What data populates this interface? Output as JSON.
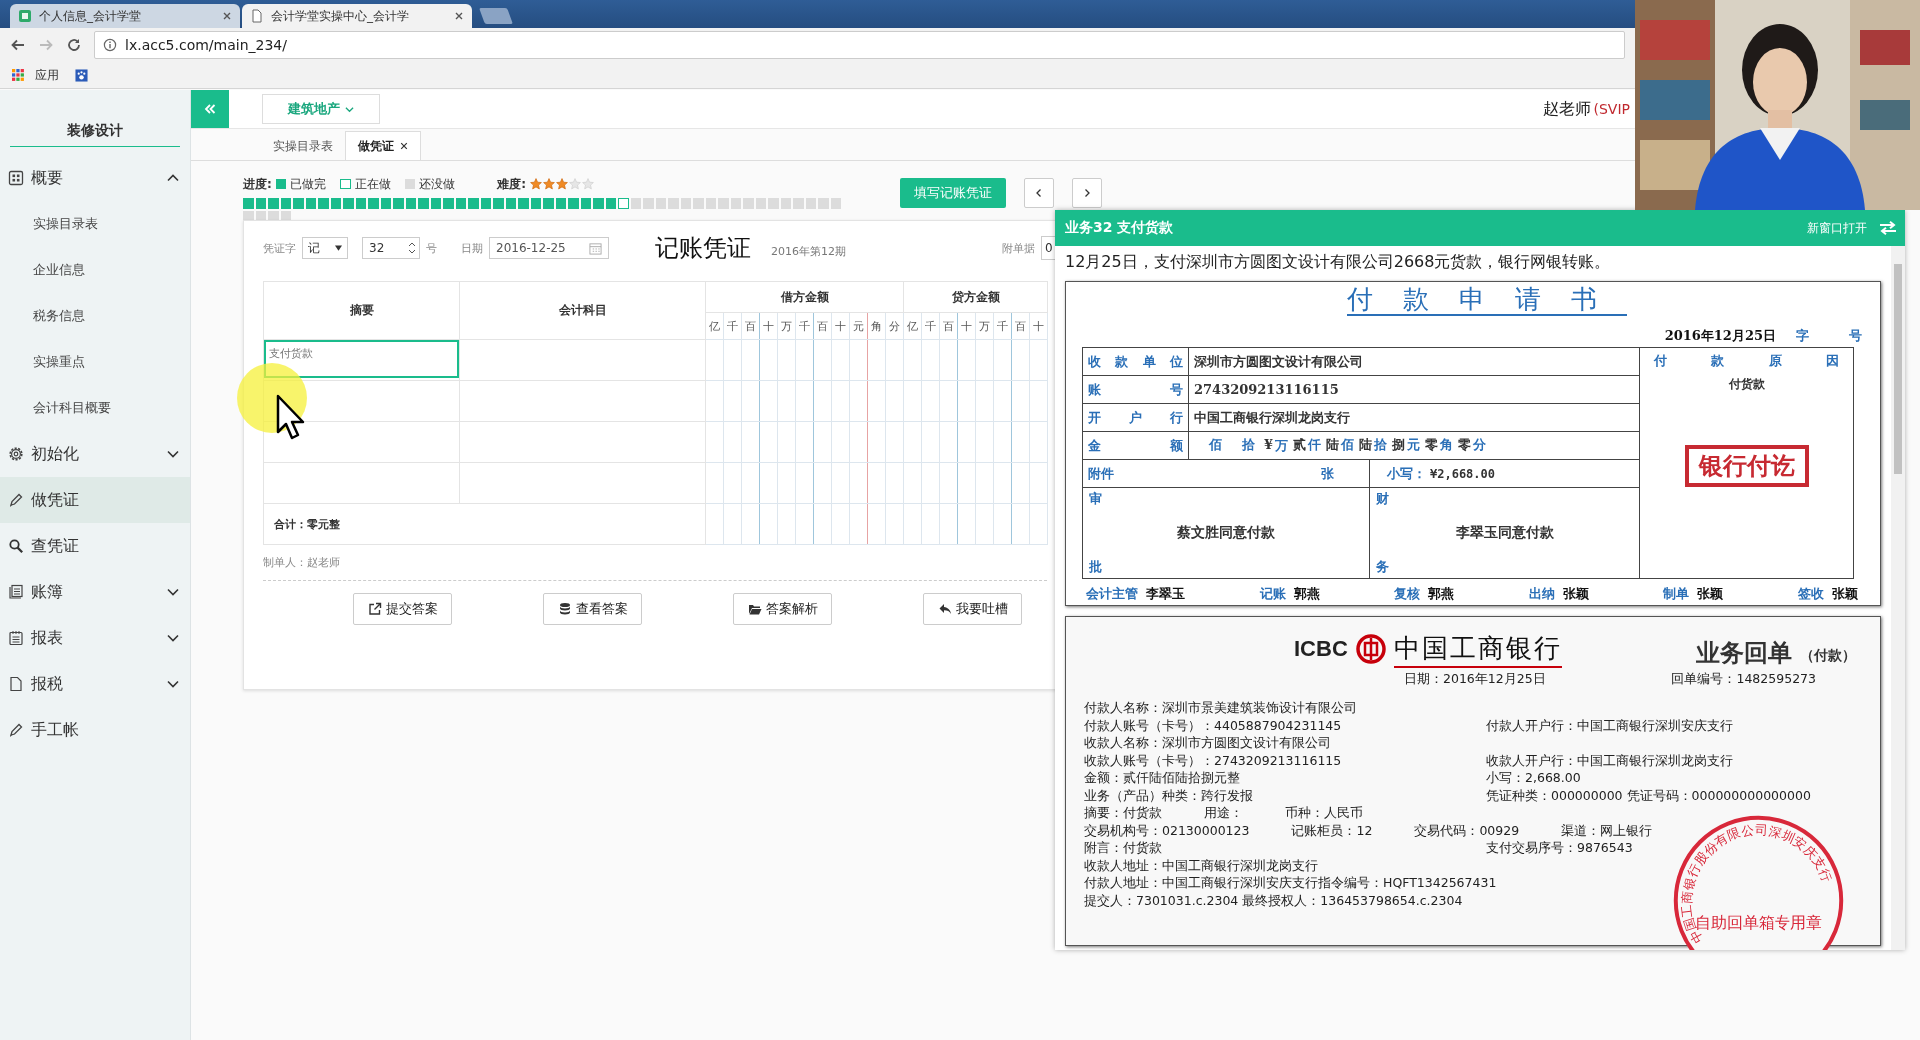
{
  "browser": {
    "tabs": [
      {
        "title": "个人信息_会计学堂",
        "selected": false
      },
      {
        "title": "会计学堂实操中心_会计学",
        "selected": true
      }
    ],
    "address": "lx.acc5.com/main_234/",
    "bookmarks": [
      "应用"
    ]
  },
  "header": {
    "dropdown": "建筑地产",
    "user_name": "赵老师",
    "user_level": "(SVIP"
  },
  "sidebar": {
    "title": "装修设计",
    "items": [
      {
        "label": "概要",
        "expanded": true,
        "selected": false,
        "children": [
          {
            "label": "实操目录表",
            "selected": false
          },
          {
            "label": "企业信息",
            "selected": false
          },
          {
            "label": "税务信息",
            "selected": false
          },
          {
            "label": "实操重点",
            "selected": false
          },
          {
            "label": "会计科目概要",
            "selected": false
          }
        ]
      },
      {
        "label": "初始化",
        "expanded": false,
        "selected": false
      },
      {
        "label": "做凭证",
        "selected": true
      },
      {
        "label": "查凭证",
        "selected": false
      },
      {
        "label": "账簿",
        "expanded": false,
        "selected": false
      },
      {
        "label": "报表",
        "expanded": false,
        "selected": false
      },
      {
        "label": "报税",
        "expanded": false,
        "selected": false
      },
      {
        "label": "手工帐",
        "selected": false
      }
    ]
  },
  "page_tabs": [
    {
      "label": "实操目录表",
      "selected": false,
      "closable": false
    },
    {
      "label": "做凭证",
      "selected": true,
      "closable": true
    }
  ],
  "progress": {
    "label": "进度:",
    "legend": [
      {
        "kind": "done",
        "label": "已做完"
      },
      {
        "kind": "current",
        "label": "正在做"
      },
      {
        "kind": "todo",
        "label": "还没做"
      }
    ],
    "difficulty_label": "难度:",
    "stars": 3,
    "cells": [
      {
        "kind": "done"
      },
      {
        "kind": "done"
      },
      {
        "kind": "done"
      },
      {
        "kind": "done"
      },
      {
        "kind": "done"
      },
      {
        "kind": "done"
      },
      {
        "kind": "done"
      },
      {
        "kind": "done"
      },
      {
        "kind": "done"
      },
      {
        "kind": "done"
      },
      {
        "kind": "done"
      },
      {
        "kind": "done"
      },
      {
        "kind": "done"
      },
      {
        "kind": "done"
      },
      {
        "kind": "done"
      },
      {
        "kind": "done"
      },
      {
        "kind": "done"
      },
      {
        "kind": "done"
      },
      {
        "kind": "done"
      },
      {
        "kind": "done"
      },
      {
        "kind": "done"
      },
      {
        "kind": "done"
      },
      {
        "kind": "done"
      },
      {
        "kind": "done"
      },
      {
        "kind": "done"
      },
      {
        "kind": "done"
      },
      {
        "kind": "done"
      },
      {
        "kind": "done"
      },
      {
        "kind": "done"
      },
      {
        "kind": "done"
      },
      {
        "kind": "current"
      },
      {
        "kind": "todo"
      },
      {
        "kind": "todo"
      },
      {
        "kind": "todo"
      },
      {
        "kind": "todo"
      },
      {
        "kind": "todo"
      },
      {
        "kind": "todo"
      },
      {
        "kind": "todo"
      },
      {
        "kind": "todo"
      },
      {
        "kind": "todo"
      },
      {
        "kind": "todo"
      },
      {
        "kind": "todo"
      },
      {
        "kind": "todo"
      },
      {
        "kind": "todo"
      },
      {
        "kind": "todo"
      },
      {
        "kind": "todo"
      },
      {
        "kind": "todo"
      },
      {
        "kind": "todo"
      },
      {
        "kind": "todo"
      },
      {
        "kind": "todo"
      },
      {
        "kind": "todo"
      },
      {
        "kind": "todo"
      }
    ]
  },
  "fill_button": "填写记账凭证",
  "voucher": {
    "type_label": "凭证字",
    "type_value": "记",
    "number": "32",
    "number_suffix": "号",
    "date_label": "日期",
    "date": "2016-12-25",
    "title": "记账凭证",
    "period": "2016年第12期",
    "attachments_label": "附单据",
    "attachments": "0",
    "columns": {
      "summary": "摘要",
      "account": "会计科目",
      "debit": "借方金额",
      "credit": "贷方金额"
    },
    "debit_units": [
      "亿",
      "千",
      "百",
      "十",
      "万",
      "千",
      "百",
      "十",
      "元",
      "角",
      "分"
    ],
    "credit_units": [
      "亿",
      "千",
      "百",
      "十",
      "万",
      "千",
      "百",
      "十"
    ],
    "rows": [
      {
        "summary": "支付货款",
        "focused": true
      },
      {
        "focused": false
      },
      {
        "focused": false
      },
      {
        "focused": false
      }
    ],
    "total": "合计：零元整",
    "maker": "制单人：赵老师",
    "buttons": [
      "提交答案",
      "查看答案",
      "答案解析",
      "我要吐槽"
    ]
  },
  "panel": {
    "title": "业务32 支付货款",
    "open_new": "新窗口打开",
    "description": "12月25日，支付深圳市方圆图文设计有限公司2668元货款，银行网银转账。",
    "request": {
      "title": "付款申请书",
      "date": "2016年12月25日",
      "zi": "字",
      "hao": "号",
      "rows": [
        {
          "label": "收款单位",
          "value": "深圳市方圆图文设计有限公司"
        },
        {
          "label": "账号",
          "value": "2743209213116115"
        },
        {
          "label": "开户行",
          "value": "中国工商银行深圳龙岗支行"
        }
      ],
      "amount_label": "金额",
      "amount_digits": [
        {
          "unit": "佰"
        },
        {
          "unit": "拾"
        },
        {
          "value": "¥",
          "unit": "万"
        },
        {
          "value": "贰",
          "unit": "仟"
        },
        {
          "value": "陆",
          "unit": "佰"
        },
        {
          "value": "陆",
          "unit": "拾"
        },
        {
          "value": "捌",
          "unit": "元"
        },
        {
          "value": "零",
          "unit": "角"
        },
        {
          "value": "零",
          "unit": "分"
        }
      ],
      "attachment_label": "附件",
      "attachment_unit": "张",
      "small_label": "小写：",
      "small_value": "¥2,668.00",
      "approve_top": "审",
      "approve_bottom": "批",
      "approve_text": "蔡文胜同意付款",
      "finance_top": "财",
      "finance_bottom": "务",
      "finance_text": "李翠玉同意付款",
      "reason_label": "付款原因",
      "reason": "付货款",
      "stamp": "银行付讫",
      "signatures": [
        {
          "role": "会计主管",
          "name": "李翠玉"
        },
        {
          "role": "记账",
          "name": "郭燕"
        },
        {
          "role": "复核",
          "name": "郭燕"
        },
        {
          "role": "出纳",
          "name": "张颖"
        },
        {
          "role": "制单",
          "name": "张颖"
        },
        {
          "role": "签收",
          "name": "张颖"
        }
      ]
    },
    "receipt": {
      "logo_text": "ICBC",
      "bank": "中国工商银行",
      "title": "业务回单",
      "title_note": "（付款）",
      "date": "日期：2016年12月25日",
      "number": "回单编号：1482595273",
      "lines": [
        [
          "付款人名称：深圳市景美建筑装饰设计有限公司"
        ],
        [
          "付款人账号（卡号）：4405887904231145",
          "付款人开户行：中国工商银行深圳安庆支行"
        ],
        [
          "收款人名称：深圳市方圆图文设计有限公司"
        ],
        [
          "收款人账号（卡号）：2743209213116115",
          "收款人开户行：中国工商银行深圳龙岗支行"
        ],
        [
          "金额：贰仟陆佰陆拾捌元整",
          "小写：2,668.00"
        ],
        [
          "业务（产品）种类：跨行发报",
          "凭证种类：000000000 凭证号码：000000000000000"
        ],
        [
          "摘要：付货款",
          "用途：",
          "币种：人民币"
        ],
        [
          "交易机构号：02130000123",
          "记账柜员：12",
          "交易代码：00929",
          "渠道：网上银行"
        ],
        [
          "附言：付货款",
          "支付交易序号：9876543"
        ],
        [
          "收款人地址：中国工商银行深圳龙岗支行"
        ],
        [
          "付款人地址：中国工商银行深圳安庆支行指令编号：HQFT1342567431"
        ],
        [
          "提交人：7301031.c.2304 最终授权人：136453798654.c.2304"
        ]
      ],
      "seal_ring": "中国工商银行股份有限公司深圳安庆支行",
      "seal_center": "自助回单箱专用章"
    }
  }
}
